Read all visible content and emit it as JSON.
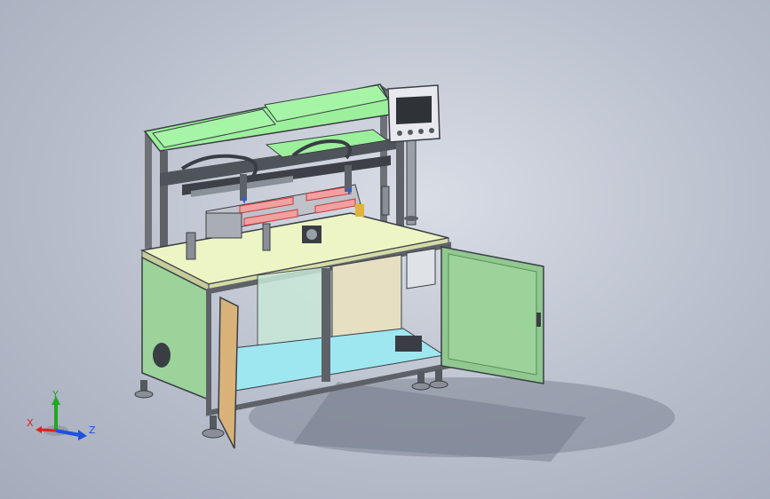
{
  "view": {
    "background_color": "#b9bfcc",
    "model_colors": {
      "panel_green": "#9bd39b",
      "top_green": "#9cf09c",
      "table_yellow": "#eef5c4",
      "floor_cyan": "#9ee6f0",
      "frame_gray": "#6e7278",
      "hmi_panel": "#e8e9ee"
    }
  },
  "triad": {
    "x_label": "X",
    "y_label": "Y",
    "z_label": "Z",
    "x_color": "#e02020",
    "y_color": "#1fa81f",
    "z_color": "#2050e0"
  }
}
